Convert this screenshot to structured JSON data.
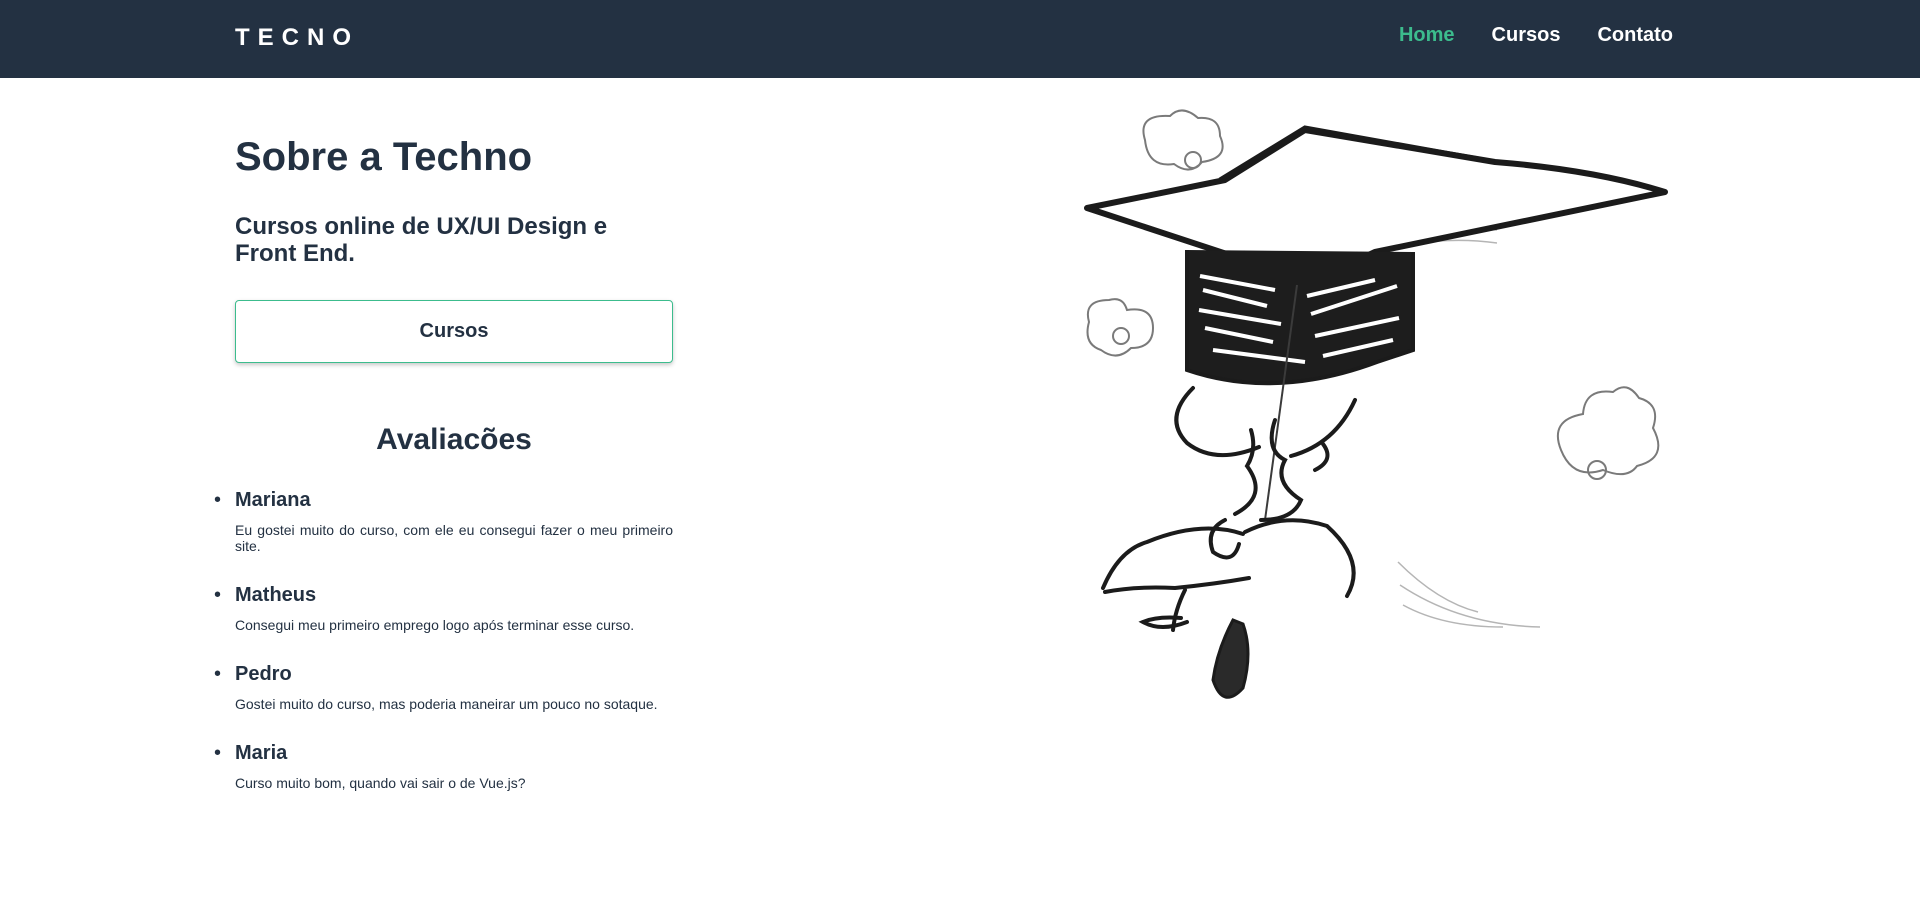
{
  "header": {
    "logo": "TECNO",
    "nav": [
      {
        "label": "Home",
        "active": true
      },
      {
        "label": "Cursos",
        "active": false
      },
      {
        "label": "Contato",
        "active": false
      }
    ]
  },
  "main": {
    "title": "Sobre a Techno",
    "subtitle": "Cursos online de UX/UI Design e Front End.",
    "cta_label": "Cursos"
  },
  "reviews": {
    "title": "Avaliacões",
    "items": [
      {
        "name": "Mariana",
        "text": "Eu gostei muito do curso, com ele eu consegui fazer o meu primeiro site."
      },
      {
        "name": "Matheus",
        "text": "Consegui meu primeiro emprego logo após terminar esse curso."
      },
      {
        "name": "Pedro",
        "text": "Gostei muito do curso, mas poderia maneirar um pouco no sotaque."
      },
      {
        "name": "Maria",
        "text": "Curso muito bom, quando vai sair o de Vue.js?"
      }
    ]
  },
  "illustration": {
    "subject": "student-flying-with-graduation-cap"
  },
  "colors": {
    "navbar": "#233142",
    "text": "#233142",
    "accent": "#3cbc8d",
    "background": "#ffffff"
  }
}
